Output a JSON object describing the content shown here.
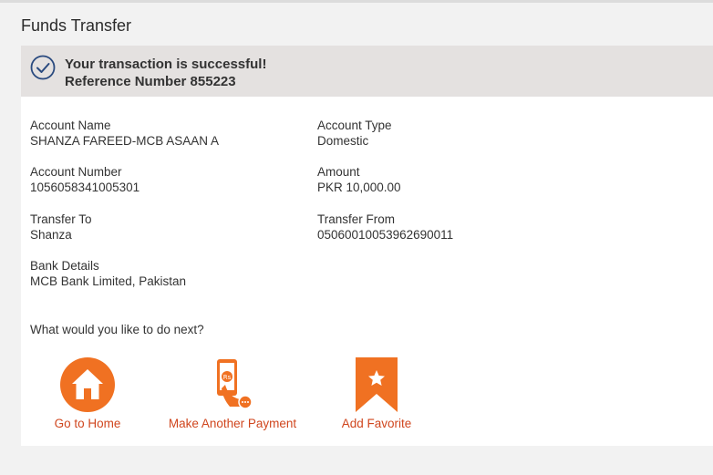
{
  "page": {
    "title": "Funds Transfer"
  },
  "banner": {
    "message": "Your transaction is successful!",
    "reference": "Reference Number 855223",
    "icon": "check-circle-icon"
  },
  "details": {
    "account_name": {
      "label": "Account Name",
      "value": "SHANZA FAREED-MCB ASAAN A"
    },
    "account_type": {
      "label": "Account Type",
      "value": "Domestic"
    },
    "account_number": {
      "label": "Account Number",
      "value": "1056058341005301"
    },
    "amount": {
      "label": "Amount",
      "value": "PKR 10,000.00"
    },
    "transfer_to": {
      "label": "Transfer To",
      "value": "Shanza"
    },
    "transfer_from": {
      "label": "Transfer From",
      "value": "05060010053962690011"
    },
    "bank_details": {
      "label": "Bank Details",
      "value": "MCB Bank Limited, Pakistan"
    }
  },
  "next": {
    "question": "What would you like to do next?",
    "actions": [
      {
        "label": "Go to Home",
        "icon": "home-icon"
      },
      {
        "label": "Make Another Payment",
        "icon": "payment-icon"
      },
      {
        "label": "Add Favorite",
        "icon": "favorite-bookmark-icon"
      }
    ]
  },
  "colors": {
    "accent": "#f07122",
    "link": "#d0461e",
    "banner_bg": "#e4e1e0",
    "check": "#2a4a7f"
  }
}
